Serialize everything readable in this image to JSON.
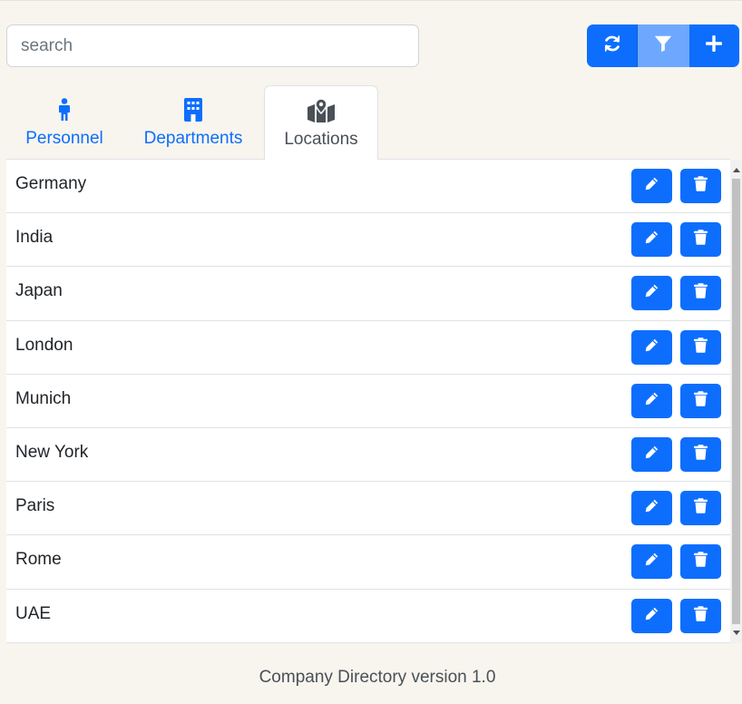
{
  "search": {
    "placeholder": "search",
    "value": ""
  },
  "toolbar": {
    "buttons": [
      {
        "icon": "refresh-icon",
        "active": false
      },
      {
        "icon": "filter-icon",
        "active": true
      },
      {
        "icon": "plus-icon",
        "active": false
      }
    ]
  },
  "tabs": [
    {
      "label": "Personnel",
      "icon": "person-icon",
      "active": false
    },
    {
      "label": "Departments",
      "icon": "building-icon",
      "active": false
    },
    {
      "label": "Locations",
      "icon": "map-location-icon",
      "active": true
    }
  ],
  "locations": [
    {
      "name": "Germany"
    },
    {
      "name": "India"
    },
    {
      "name": "Japan"
    },
    {
      "name": "London"
    },
    {
      "name": "Munich"
    },
    {
      "name": "New York"
    },
    {
      "name": "Paris"
    },
    {
      "name": "Rome"
    },
    {
      "name": "UAE"
    }
  ],
  "row_actions": {
    "edit_icon": "pencil-icon",
    "delete_icon": "trash-icon"
  },
  "footer": {
    "text": "Company Directory version 1.0"
  },
  "colors": {
    "primary": "#0d6efd",
    "primary_active": "#6ea8fe",
    "background": "#f8f5ee"
  }
}
